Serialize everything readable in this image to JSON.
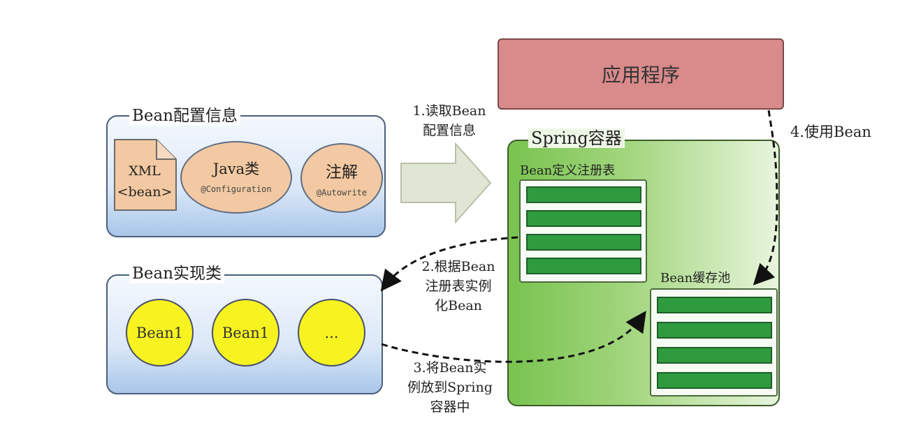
{
  "config_group": {
    "title": "Bean配置信息",
    "xml_line1": "XML",
    "xml_line2": "<bean>",
    "java_title": "Java类",
    "java_sub": "@Configuration",
    "annotation_title": "注解",
    "annotation_sub": "@Autowrite"
  },
  "impl_group": {
    "title": "Bean实现类",
    "beans": [
      "Bean1",
      "Bean1",
      "..."
    ]
  },
  "app": {
    "label": "应用程序"
  },
  "spring": {
    "title": "Spring容器",
    "registry_title": "Bean定义注册表",
    "cache_title": "Bean缓存池"
  },
  "steps": {
    "step1": [
      "1.读取Bean",
      "配置信息"
    ],
    "step2": [
      "2.根据Bean",
      "注册表实例",
      "化Bean"
    ],
    "step3": [
      "3.将Bean实",
      "例放到Spring",
      "容器中"
    ],
    "step4": "4.使用Bean"
  },
  "colors": {
    "app_box": "#d98a8a",
    "container_green": "#79c34f",
    "bean_yellow": "#f6f321",
    "ellipse_orange": "#f2c9a2",
    "registry_row": "#2e9b3f"
  }
}
